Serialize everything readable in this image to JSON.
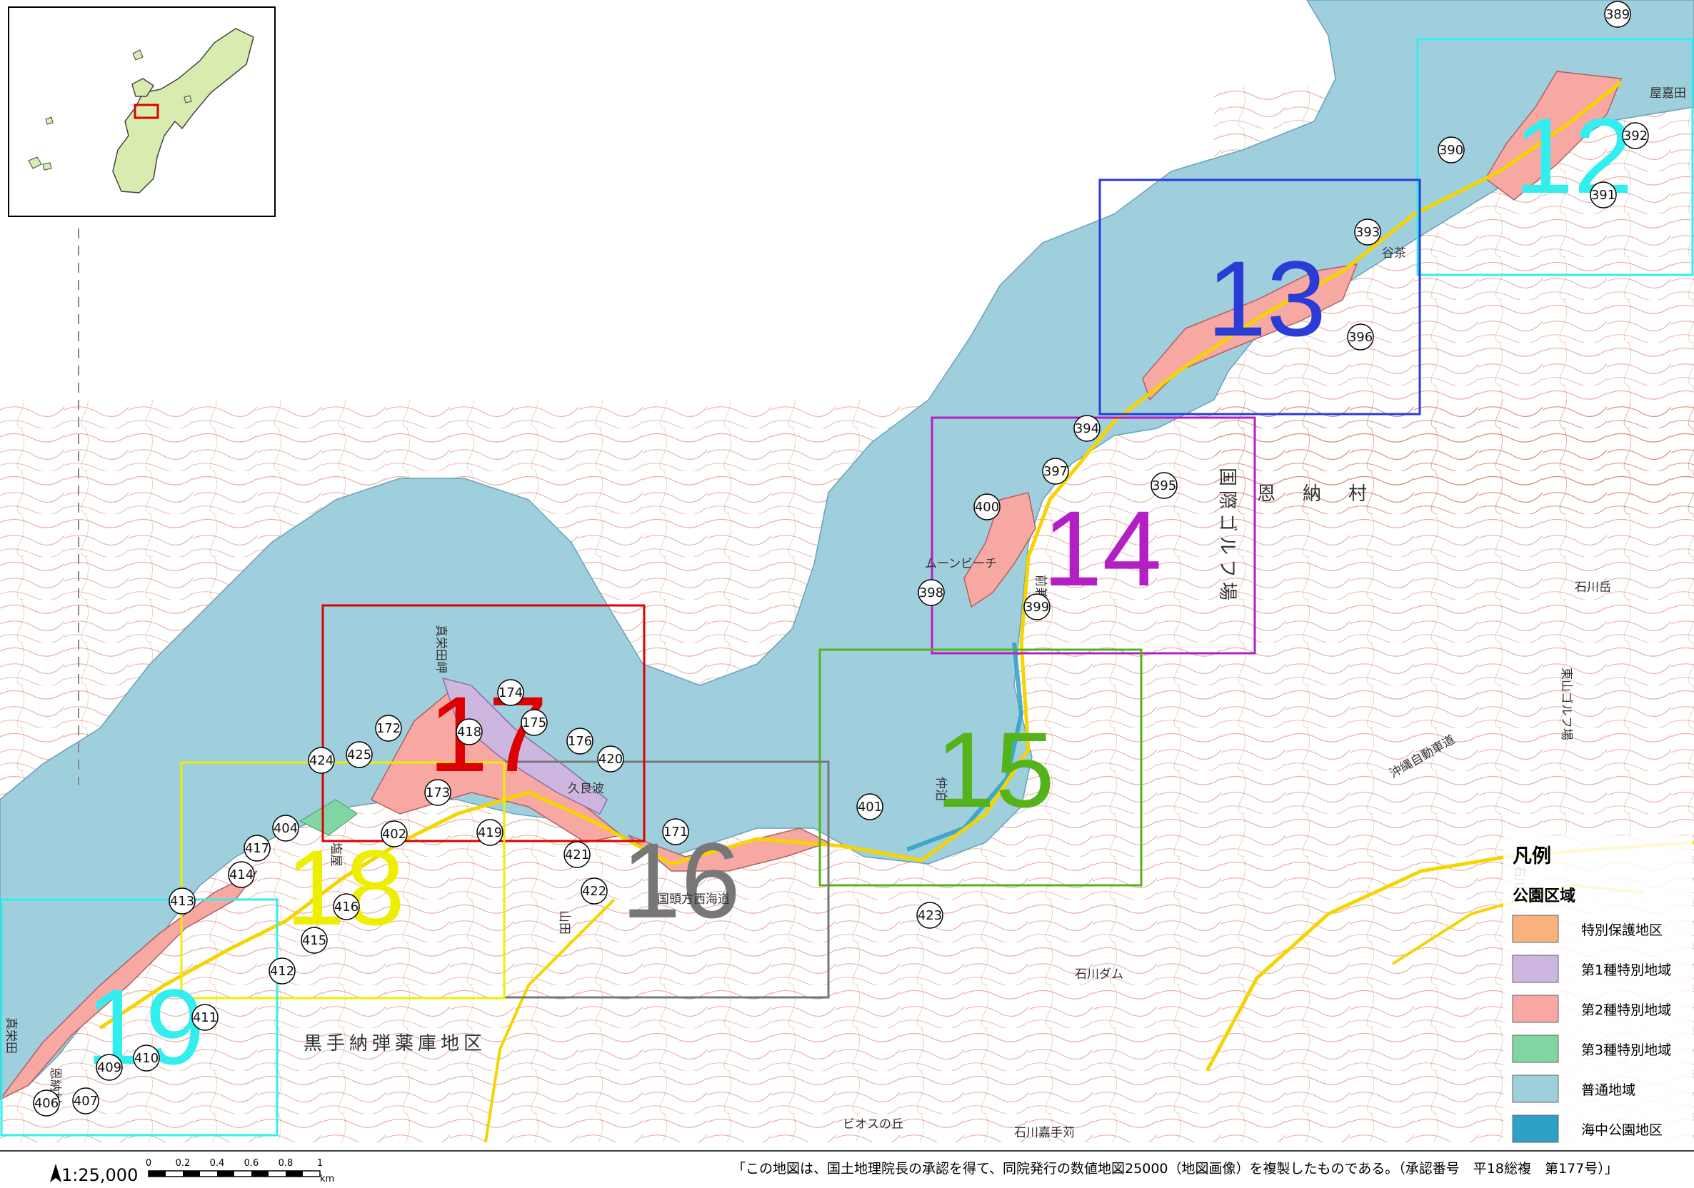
{
  "map": {
    "scale_text": "1:25,000",
    "scalebar_ticks": [
      "0",
      "0.2",
      "0.4",
      "0.6",
      "0.8",
      "1"
    ],
    "scalebar_unit": "km",
    "copyright_note": "「この地図は、国土地理院長の承認を得て、同院発行の数値地図25000（地図画像）を複製したものである。（承認番号　平18総複　第177号）」",
    "colors": {
      "sea": "#9fcfdd",
      "marine_park": "#2fa0c8",
      "special_protection": "#f8b27e",
      "class1_special": "#cdb6df",
      "class2_special": "#f7a8a3",
      "class3_special": "#82d6a4",
      "land": "#ffffff",
      "contour": "#d06a55",
      "road": "#f5d400"
    },
    "sheets": [
      {
        "number": "12",
        "color": "#33eeee"
      },
      {
        "number": "13",
        "color": "#2a3bd6"
      },
      {
        "number": "14",
        "color": "#b41fc4"
      },
      {
        "number": "15",
        "color": "#55b31a"
      },
      {
        "number": "16",
        "color": "#777777"
      },
      {
        "number": "17",
        "color": "#dd0000"
      },
      {
        "number": "18",
        "color": "#eeee00"
      },
      {
        "number": "19",
        "color": "#33eeee"
      }
    ],
    "point_markers": [
      "389",
      "390",
      "391",
      "392",
      "393",
      "394",
      "395",
      "396",
      "397",
      "398",
      "399",
      "400",
      "401",
      "402",
      "404",
      "406",
      "407",
      "409",
      "410",
      "411",
      "412",
      "413",
      "414",
      "415",
      "416",
      "417",
      "418",
      "419",
      "420",
      "421",
      "422",
      "423",
      "424",
      "425",
      "171",
      "172",
      "173",
      "174",
      "175",
      "176"
    ],
    "place_names": [
      "恩　納　村",
      "国際ゴルフ場",
      "黒手納弾薬庫地区",
      "国頭方西海道",
      "石川嘉手苅",
      "ビオスの丘",
      "東山ゴルフ場",
      "石川岳",
      "石川ダム",
      "石川",
      "久良波",
      "仲泊",
      "谷茶",
      "屋嘉田",
      "真栄田岬",
      "ムーンビーチ",
      "前兼久",
      "山田",
      "塩屋",
      "真栄田",
      "恩納村",
      "沖縄自動車道"
    ]
  },
  "legend": {
    "title": "凡例",
    "subtitle": "公園区域",
    "items": [
      {
        "label": "特別保護地区",
        "color": "#f8b27e"
      },
      {
        "label": "第1種特別地域",
        "color": "#cdb6df"
      },
      {
        "label": "第2種特別地域",
        "color": "#f7a8a3"
      },
      {
        "label": "第3種特別地域",
        "color": "#82d6a4"
      },
      {
        "label": "普通地域",
        "color": "#9fcfdd"
      },
      {
        "label": "海中公園地区",
        "color": "#2fa0c8"
      }
    ]
  },
  "inset": {
    "land_color": "#d8ecb0"
  }
}
